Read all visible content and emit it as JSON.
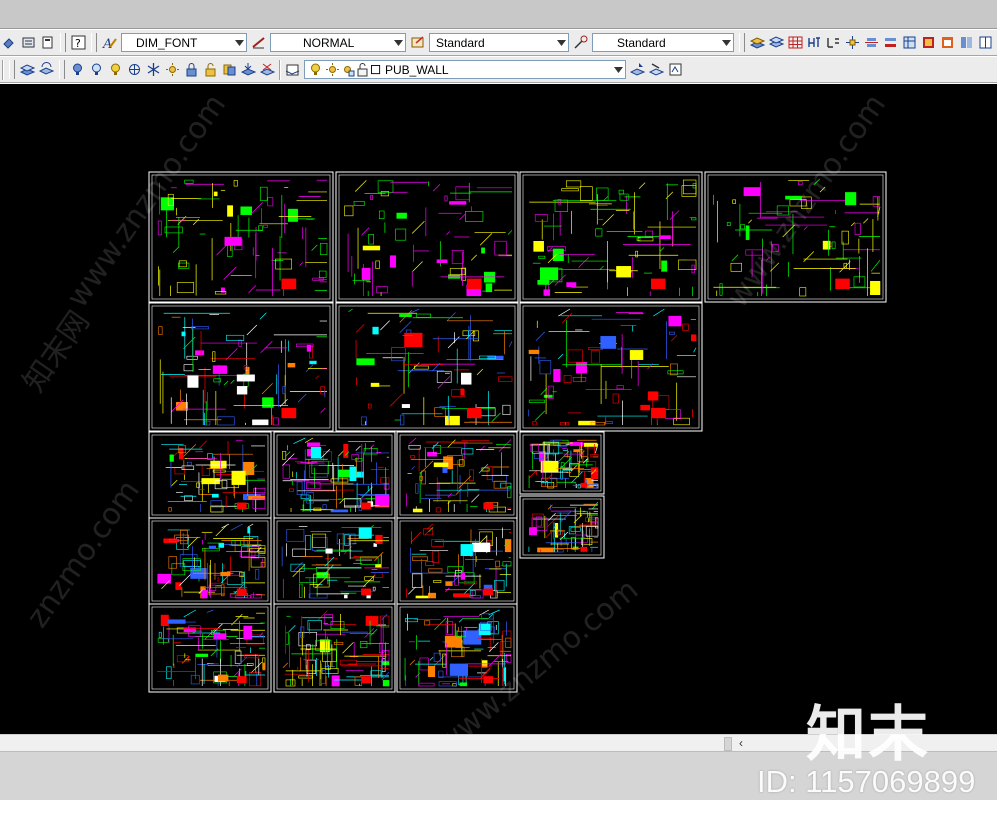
{
  "toolbar_top": {
    "text_style": "DIM_FONT",
    "dim_style": "NORMAL",
    "table_style": "Standard",
    "multileader_style": "Standard"
  },
  "toolbar_layers": {
    "current_layer": "PUB_WALL"
  },
  "watermark": {
    "brand": "知末",
    "id_text": "ID: 1157069899",
    "site": "www.znzmo.com",
    "site_short": "znzmo.com",
    "brand_cn": "知末网"
  },
  "colors": {
    "canvas": "#000000",
    "sheet_border": "#ffffff",
    "toolbar": "#ececec"
  }
}
